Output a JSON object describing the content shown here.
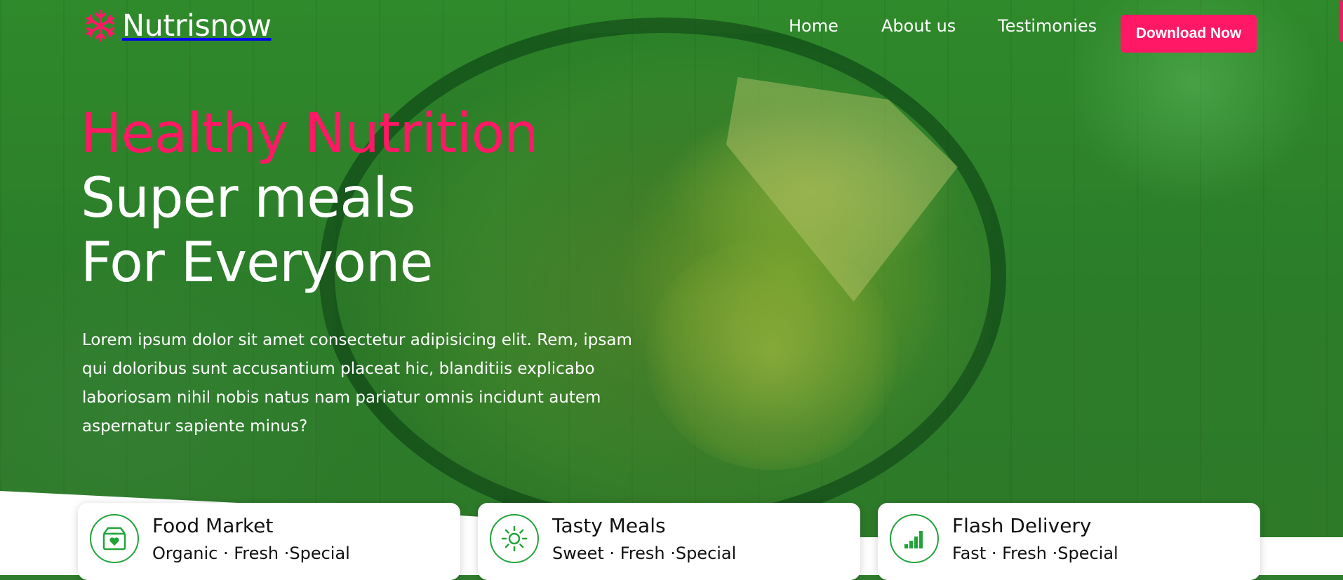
{
  "brand": {
    "name": "Nutrisnow",
    "logo_icon": "snowflake-icon",
    "logo_color": "#ff1865"
  },
  "nav": {
    "items": [
      {
        "label": "Home"
      },
      {
        "label": "About us"
      },
      {
        "label": "Testimonies"
      }
    ],
    "cta_label": "Download Now"
  },
  "hero": {
    "title_line1": "Healthy Nutrition",
    "title_line2": "Super meals",
    "title_line3": "For Everyone",
    "description": "Lorem ipsum dolor sit amet consectetur adipisicing elit. Rem, ipsam qui doloribus sunt accusantium placeat hic, blanditiis explicabo laboriosam nihil nobis natus nam pariatur omnis incidunt autem aspernatur sapiente minus?"
  },
  "features": [
    {
      "title": "Food Market",
      "subtitle": "Organic · Fresh ·Special",
      "icon": "box-heart-icon"
    },
    {
      "title": "Tasty Meals",
      "subtitle": "Sweet · Fresh ·Special",
      "icon": "sun-icon"
    },
    {
      "title": "Flash Delivery",
      "subtitle": "Fast · Fresh ·Special",
      "icon": "signal-bars-icon"
    }
  ],
  "colors": {
    "accent": "#ff1865",
    "overlay_green": "#2e8b2e",
    "icon_green": "#22a33a",
    "text_light": "#ffffff"
  }
}
